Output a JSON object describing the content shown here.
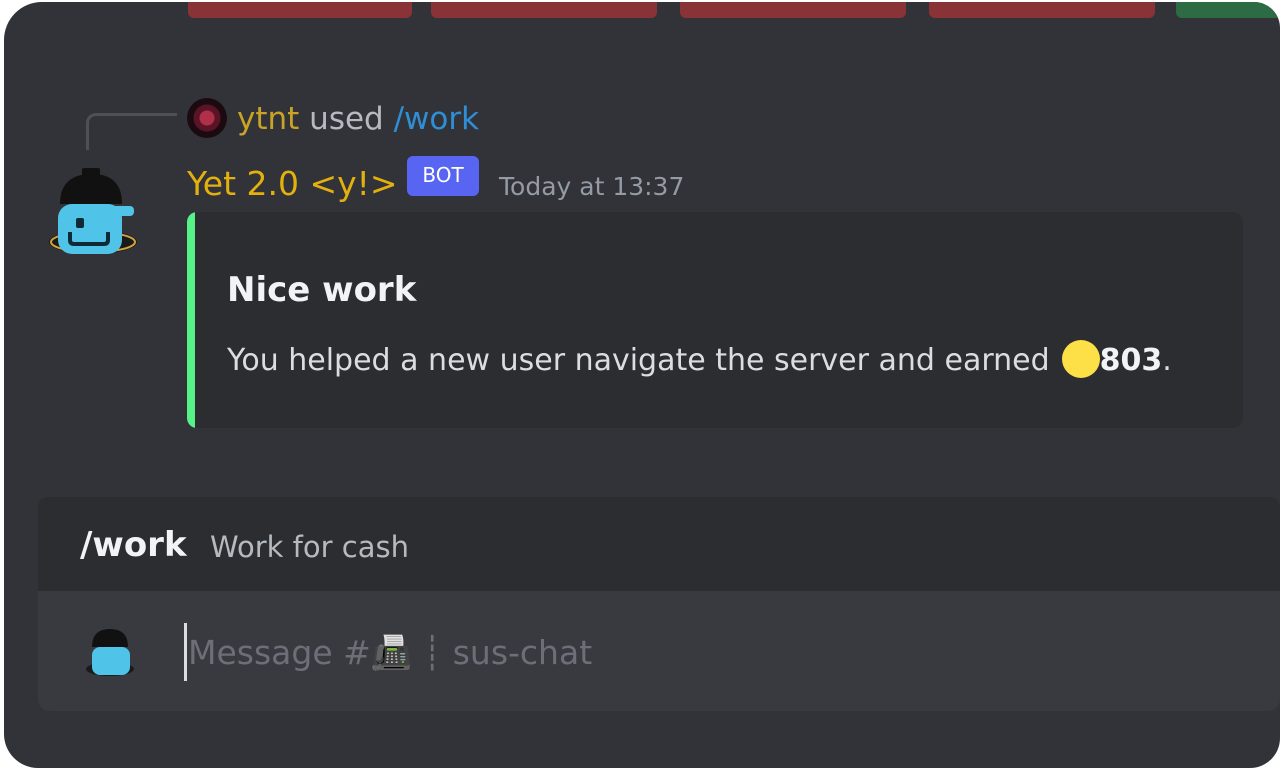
{
  "reply": {
    "username": "ytnt",
    "verb": "used",
    "command": "/work"
  },
  "message": {
    "author": "Yet 2.0 <y!>",
    "bot_tag": "BOT",
    "timestamp": "Today at 13:37",
    "embed": {
      "title": "Nice work",
      "description": "You helped a new user navigate the server and earned",
      "amount": "803",
      "amount_suffix": ".",
      "accent_color": "#57f287",
      "coin_icon": "coin-icon"
    }
  },
  "command_hint": {
    "name": "/work",
    "description": "Work for cash"
  },
  "composer": {
    "placeholder": "Message #📠 ┊ sus-chat",
    "channel_name": "sus-chat"
  },
  "colors": {
    "background": "#313338",
    "bot_name": "#e3b00e",
    "bot_tag": "#5865f2",
    "reply_user": "#c9a227",
    "command_link": "#2e8fd6",
    "danger_button": "#8a3337",
    "success_button": "#2d6b44"
  }
}
